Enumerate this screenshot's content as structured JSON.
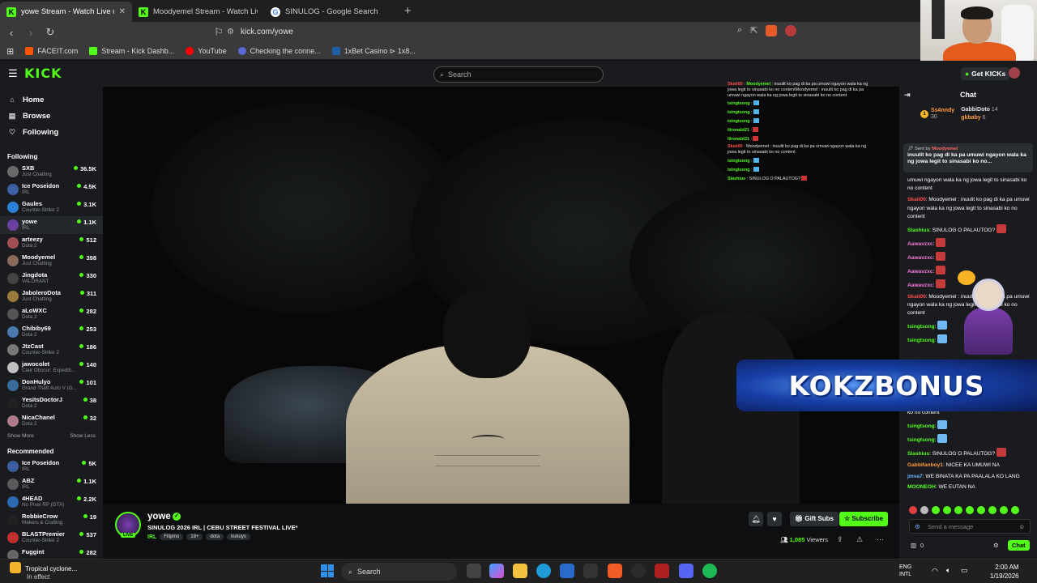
{
  "browser": {
    "tabs": [
      {
        "title": "yowe Stream - Watch Live on",
        "icon": "kick",
        "active": true
      },
      {
        "title": "Moodyemel Stream - Watch Live on",
        "icon": "kick",
        "active": false
      },
      {
        "title": "SINULOG - Google Search",
        "icon": "google",
        "active": false
      }
    ],
    "url": "kick.com/yowe",
    "bookmarks": [
      "FACEIT.com",
      "Stream - Kick Dashb...",
      "YouTube",
      "Checking the conne...",
      "1xBet Casino ⊳ 1x8..."
    ]
  },
  "kick": {
    "logo": "KICK",
    "search_placeholder": "Search",
    "get_kicks": "Get KICKs"
  },
  "sidebar": {
    "nav": [
      "Home",
      "Browse",
      "Following"
    ],
    "following_title": "Following",
    "following": [
      {
        "name": "SXB",
        "category": "Just Chatting",
        "viewers": "36.5K",
        "color": "#6a6a6a"
      },
      {
        "name": "Ice Poseidon",
        "category": "IRL",
        "viewers": "4.5K",
        "color": "#3b5fa0"
      },
      {
        "name": "Gaules",
        "category": "Counter-Strike 2",
        "viewers": "3.1K",
        "color": "#2b7fd4"
      },
      {
        "name": "yowe",
        "category": "IRL",
        "viewers": "1.1K",
        "color": "#6b3fa0"
      },
      {
        "name": "arteezy",
        "category": "Dota 2",
        "viewers": "512",
        "color": "#a05050"
      },
      {
        "name": "Moodyemel",
        "category": "Just Chatting",
        "viewers": "398",
        "color": "#8a6a5a"
      },
      {
        "name": "Jingdota",
        "category": "VALORANT",
        "viewers": "330",
        "color": "#444"
      },
      {
        "name": "JaboleroDota",
        "category": "Just Chatting",
        "viewers": "311",
        "color": "#9a7a3a"
      },
      {
        "name": "aLoWXC",
        "category": "Dota 2",
        "viewers": "282",
        "color": "#555"
      },
      {
        "name": "Chibiby69",
        "category": "Dota 2",
        "viewers": "253",
        "color": "#4a7ab0"
      },
      {
        "name": "JtzCast",
        "category": "Counter-Strike 2",
        "viewers": "186",
        "color": "#777"
      },
      {
        "name": "jawocolet",
        "category": "Clair Obscur: Expediti...",
        "viewers": "140",
        "color": "#c0c0c0"
      },
      {
        "name": "DonHulyo",
        "category": "Grand Theft Auto V (G...",
        "viewers": "101",
        "color": "#3a6a9a"
      },
      {
        "name": "YesitsDoctorJ",
        "category": "Dota 2",
        "viewers": "38",
        "color": "#222"
      },
      {
        "name": "NicaChanel",
        "category": "Dota 2",
        "viewers": "32",
        "color": "#b07a8a"
      }
    ],
    "show_more": "Show More",
    "show_less": "Show Less",
    "recommended_title": "Recommended",
    "recommended": [
      {
        "name": "Ice Poseidon",
        "category": "IRL",
        "viewers": "5K",
        "color": "#3b5fa0"
      },
      {
        "name": "ABZ",
        "category": "IRL",
        "viewers": "1.1K",
        "color": "#5a5a5a"
      },
      {
        "name": "4HEAD",
        "category": "No Pixel RP (GTA)",
        "viewers": "2.2K",
        "color": "#2a6ab0"
      },
      {
        "name": "RobbieCrow",
        "category": "Makers & Crafting",
        "viewers": "19",
        "color": "#222"
      },
      {
        "name": "BLASTPremier",
        "category": "Counter-Strike 2",
        "viewers": "537",
        "color": "#c03030"
      },
      {
        "name": "Fuggint",
        "category": "",
        "viewers": "282",
        "color": "#666"
      }
    ]
  },
  "overlay_chat": [
    {
      "user": "Moodyemel",
      "red": false,
      "text": ": inuulit ko pag di ka pa umuwi ngayon wala ka ng jowa legit to sinasabi ko no contentMoodyemel : inuulit ko pag di ka pa umuwi ngayon wala ka ng jowa legit to sinasabi ko no content",
      "prefix": "Skaii00 :"
    },
    {
      "user": "tsingtsong",
      "text": ":",
      "emote": "b"
    },
    {
      "user": "tsingtsong",
      "text": ":",
      "emote": "b"
    },
    {
      "user": "tsingtsong",
      "text": ":",
      "emote": "b"
    },
    {
      "user": "lilronald21",
      "text": ":",
      "emote": "r"
    },
    {
      "user": "lilronald21",
      "text": ":",
      "emote": "r"
    },
    {
      "user": "Skaii00",
      "red": true,
      "text": ": Moodyemel : inuulit ko pag di ka pa umuwi ngayon wala ka ng jowa legit to sinasabi ko no content"
    },
    {
      "user": "tsingtsong",
      "text": ":",
      "emote": "b"
    },
    {
      "user": "tsingtsong",
      "text": ":",
      "emote": "b"
    },
    {
      "user": "Slashius",
      "text": ": SINULOG O PALAUTOG?",
      "emote": "r"
    }
  ],
  "channel": {
    "name": "yowe",
    "live": "LIVE",
    "title": "SINULOG 2026 IRL | CEBU STREET FESTIVAL LIVE*",
    "category": "IRL",
    "tags": [
      "Filipino",
      "18+",
      "dota",
      "kukuys"
    ],
    "gift_subs": "Gift Subs",
    "subscribe": "Subscribe",
    "viewers": "1,085",
    "viewers_label": "Viewers"
  },
  "chat": {
    "title": "Chat",
    "leaders": [
      {
        "name": "Ss4nndy",
        "count": "30",
        "color": "#ff9a3c"
      },
      {
        "name": "GabbiDoto",
        "count": "14",
        "color": "#fff"
      },
      {
        "name": "gkbaby",
        "count": "6",
        "color": "#ff9a3c"
      }
    ],
    "pinned_sent_by": "Sent by",
    "pinned_user": "Moodyemel",
    "pinned_text": "inuulit ko pag di ka pa umuwi ngayon wala ka ng jowa legit to sinasabi ko no...",
    "messages": [
      {
        "user": "",
        "cls": "",
        "text": "umuwi ngayon wala ka ng jowa legit to sinasabi ko no content"
      },
      {
        "user": "Skaii00",
        "cls": "red",
        "text": ": Moodyemel : inuulit ko pag di ka pa umuwi ngayon wala ka ng jowa legit to sinasabi ko no content"
      },
      {
        "user": "Slashius",
        "cls": "",
        "text": ": SINULOG O PALAUTOG?",
        "emote": "r"
      },
      {
        "user": "Aawavzxc",
        "cls": "pink",
        "text": ":",
        "emote": "r"
      },
      {
        "user": "Aawavzxc",
        "cls": "pink",
        "text": ":",
        "emote": "r"
      },
      {
        "user": "Aawavzxc",
        "cls": "pink",
        "text": ":",
        "emote": "r"
      },
      {
        "user": "Aawavzxc",
        "cls": "pink",
        "text": ":",
        "emote": "r"
      },
      {
        "user": "Skaii00",
        "cls": "red",
        "text": ": Moodyemel : inuulit ko pag di ka pa umuwi ngayon wala ka ng jowa legit to sinasabi ko no content"
      },
      {
        "user": "tsingtsong",
        "cls": "",
        "text": ":",
        "emote": "b"
      },
      {
        "user": "tsingtsong",
        "cls": "",
        "text": ":",
        "emote": "b"
      }
    ],
    "messages_bottom": [
      {
        "user": "",
        "cls": "",
        "text": "ko no content"
      },
      {
        "user": "tsingtsong",
        "cls": "",
        "text": ":",
        "emote": "b"
      },
      {
        "user": "tsingtsong",
        "cls": "",
        "text": ":",
        "emote": "b"
      },
      {
        "user": "Slashius",
        "cls": "",
        "text": ": SINULOG O PALAUTOG?",
        "emote": "r"
      },
      {
        "user": "Gabbifanboy1",
        "cls": "orange",
        "text": ": NICEE KA UMUWI NA"
      },
      {
        "user": "jmva7",
        "cls": "blue",
        "text": ": WE BINATA KA PA PAALALA KO LANG"
      },
      {
        "user": "MOONEOH",
        "cls": "",
        "text": ": WE EUTAN NA"
      }
    ],
    "send_placeholder": "Send a message",
    "points": "0",
    "chat_button": "Chat"
  },
  "promo": {
    "text": "KOKZBONUS"
  },
  "taskbar": {
    "weather_title": "Tropical cyclone...",
    "weather_sub": "In effect",
    "search": "Search",
    "lang": "ENG",
    "lang_sub": "INTL",
    "time": "2:00 AM",
    "date": "1/19/2026"
  }
}
